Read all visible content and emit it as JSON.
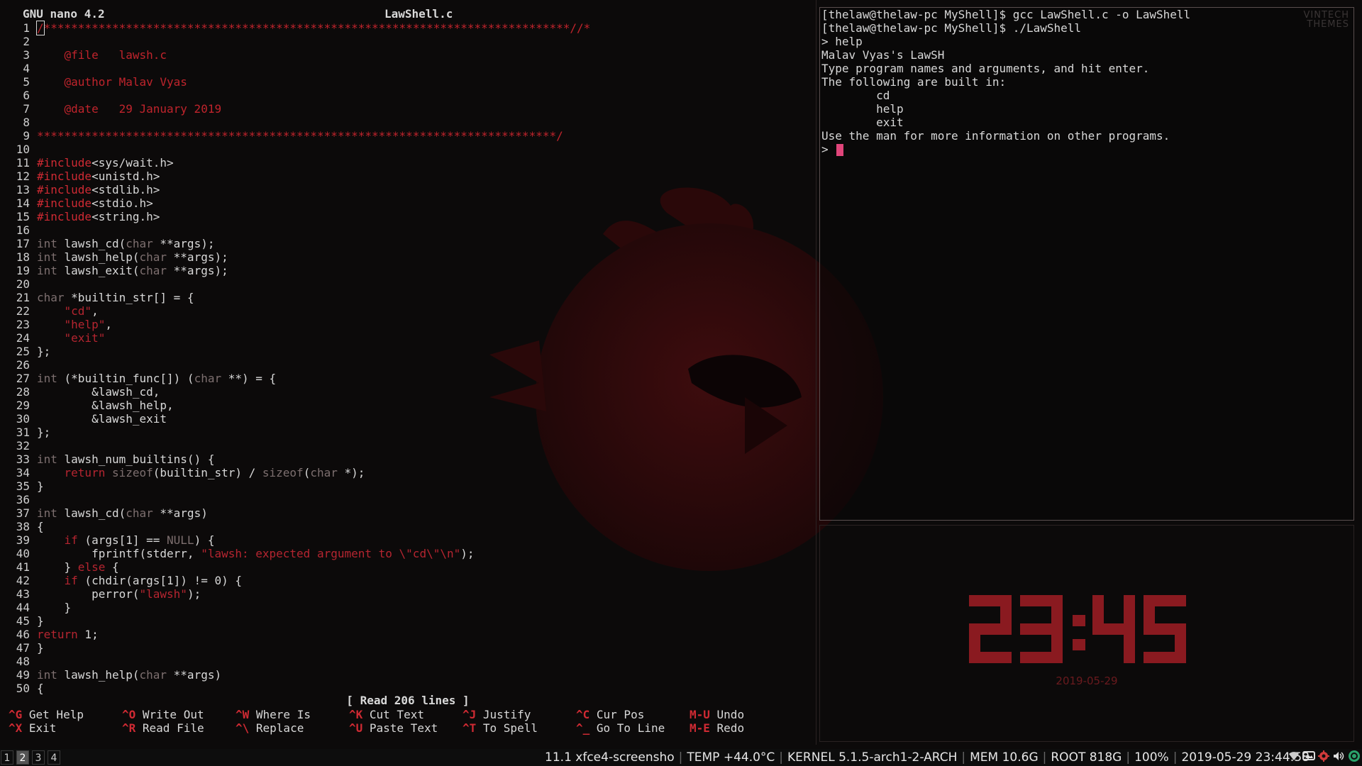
{
  "nano": {
    "version": "GNU nano 4.2",
    "filename": "LawShell.c",
    "status": "[ Read 206 lines ]",
    "lines": [
      {
        "n": "1",
        "seg": [
          [
            "comment",
            "/*****************************************************************************//*"
          ]
        ]
      },
      {
        "n": "2",
        "seg": []
      },
      {
        "n": "3",
        "seg": [
          [
            "comment",
            "    @file   lawsh.c"
          ]
        ]
      },
      {
        "n": "4",
        "seg": []
      },
      {
        "n": "5",
        "seg": [
          [
            "comment",
            "    @author Malav Vyas"
          ]
        ]
      },
      {
        "n": "6",
        "seg": []
      },
      {
        "n": "7",
        "seg": [
          [
            "comment",
            "    @date   29 January 2019"
          ]
        ]
      },
      {
        "n": "8",
        "seg": []
      },
      {
        "n": "9",
        "seg": [
          [
            "comment",
            "****************************************************************************/"
          ]
        ]
      },
      {
        "n": "10",
        "seg": []
      },
      {
        "n": "11",
        "seg": [
          [
            "pre",
            "#include"
          ],
          [
            "inc",
            "<sys/wait.h>"
          ]
        ]
      },
      {
        "n": "12",
        "seg": [
          [
            "pre",
            "#include"
          ],
          [
            "inc",
            "<unistd.h>"
          ]
        ]
      },
      {
        "n": "13",
        "seg": [
          [
            "pre",
            "#include"
          ],
          [
            "inc",
            "<stdlib.h>"
          ]
        ]
      },
      {
        "n": "14",
        "seg": [
          [
            "pre",
            "#include"
          ],
          [
            "inc",
            "<stdio.h>"
          ]
        ]
      },
      {
        "n": "15",
        "seg": [
          [
            "pre",
            "#include"
          ],
          [
            "inc",
            "<string.h>"
          ]
        ]
      },
      {
        "n": "16",
        "seg": []
      },
      {
        "n": "17",
        "seg": [
          [
            "type",
            "int"
          ],
          [
            "norm",
            " lawsh_cd("
          ],
          [
            "type",
            "char"
          ],
          [
            "norm",
            " **args);"
          ]
        ]
      },
      {
        "n": "18",
        "seg": [
          [
            "type",
            "int"
          ],
          [
            "norm",
            " lawsh_help("
          ],
          [
            "type",
            "char"
          ],
          [
            "norm",
            " **args);"
          ]
        ]
      },
      {
        "n": "19",
        "seg": [
          [
            "type",
            "int"
          ],
          [
            "norm",
            " lawsh_exit("
          ],
          [
            "type",
            "char"
          ],
          [
            "norm",
            " **args);"
          ]
        ]
      },
      {
        "n": "20",
        "seg": []
      },
      {
        "n": "21",
        "seg": [
          [
            "type",
            "char"
          ],
          [
            "norm",
            " *builtin_str[] = {"
          ]
        ]
      },
      {
        "n": "22",
        "seg": [
          [
            "norm",
            "    "
          ],
          [
            "str",
            "\"cd\""
          ],
          [
            "norm",
            ","
          ]
        ]
      },
      {
        "n": "23",
        "seg": [
          [
            "norm",
            "    "
          ],
          [
            "str",
            "\"help\""
          ],
          [
            "norm",
            ","
          ]
        ]
      },
      {
        "n": "24",
        "seg": [
          [
            "norm",
            "    "
          ],
          [
            "str",
            "\"exit\""
          ]
        ]
      },
      {
        "n": "25",
        "seg": [
          [
            "norm",
            "};"
          ]
        ]
      },
      {
        "n": "26",
        "seg": []
      },
      {
        "n": "27",
        "seg": [
          [
            "type",
            "int"
          ],
          [
            "norm",
            " (*builtin_func[]) ("
          ],
          [
            "type",
            "char"
          ],
          [
            "norm",
            " **) = {"
          ]
        ]
      },
      {
        "n": "28",
        "seg": [
          [
            "norm",
            "        &lawsh_cd,"
          ]
        ]
      },
      {
        "n": "29",
        "seg": [
          [
            "norm",
            "        &lawsh_help,"
          ]
        ]
      },
      {
        "n": "30",
        "seg": [
          [
            "norm",
            "        &lawsh_exit"
          ]
        ]
      },
      {
        "n": "31",
        "seg": [
          [
            "norm",
            "};"
          ]
        ]
      },
      {
        "n": "32",
        "seg": []
      },
      {
        "n": "33",
        "seg": [
          [
            "type",
            "int"
          ],
          [
            "norm",
            " lawsh_num_builtins() {"
          ]
        ]
      },
      {
        "n": "34",
        "seg": [
          [
            "norm",
            "    "
          ],
          [
            "kw",
            "return"
          ],
          [
            "norm",
            " "
          ],
          [
            "type",
            "sizeof"
          ],
          [
            "norm",
            "(builtin_str) / "
          ],
          [
            "type",
            "sizeof"
          ],
          [
            "norm",
            "("
          ],
          [
            "type",
            "char"
          ],
          [
            "norm",
            " *);"
          ]
        ]
      },
      {
        "n": "35",
        "seg": [
          [
            "norm",
            "}"
          ]
        ]
      },
      {
        "n": "36",
        "seg": []
      },
      {
        "n": "37",
        "seg": [
          [
            "type",
            "int"
          ],
          [
            "norm",
            " lawsh_cd("
          ],
          [
            "type",
            "char"
          ],
          [
            "norm",
            " **args)"
          ]
        ]
      },
      {
        "n": "38",
        "seg": [
          [
            "norm",
            "{"
          ]
        ]
      },
      {
        "n": "39",
        "seg": [
          [
            "norm",
            "    "
          ],
          [
            "kw",
            "if"
          ],
          [
            "norm",
            " (args[1] == "
          ],
          [
            "null",
            "NULL"
          ],
          [
            "norm",
            ") {"
          ]
        ]
      },
      {
        "n": "40",
        "seg": [
          [
            "norm",
            "        fprintf(stderr, "
          ],
          [
            "str",
            "\"lawsh: expected argument to \\\"cd\\\"\\n\""
          ],
          [
            "norm",
            ");"
          ]
        ]
      },
      {
        "n": "41",
        "seg": [
          [
            "norm",
            "    } "
          ],
          [
            "kw",
            "else"
          ],
          [
            "norm",
            " {"
          ]
        ]
      },
      {
        "n": "42",
        "seg": [
          [
            "norm",
            "    "
          ],
          [
            "kw",
            "if"
          ],
          [
            "norm",
            " (chdir(args[1]) != 0) {"
          ]
        ]
      },
      {
        "n": "43",
        "seg": [
          [
            "norm",
            "        perror("
          ],
          [
            "str",
            "\"lawsh\""
          ],
          [
            "norm",
            ");"
          ]
        ]
      },
      {
        "n": "44",
        "seg": [
          [
            "norm",
            "    }"
          ]
        ]
      },
      {
        "n": "45",
        "seg": [
          [
            "norm",
            "}"
          ]
        ]
      },
      {
        "n": "46",
        "seg": [
          [
            "kw",
            "return"
          ],
          [
            "norm",
            " 1;"
          ]
        ]
      },
      {
        "n": "47",
        "seg": [
          [
            "norm",
            "}"
          ]
        ]
      },
      {
        "n": "48",
        "seg": []
      },
      {
        "n": "49",
        "seg": [
          [
            "type",
            "int"
          ],
          [
            "norm",
            " lawsh_help("
          ],
          [
            "type",
            "char"
          ],
          [
            "norm",
            " **args)"
          ]
        ]
      },
      {
        "n": "50",
        "seg": [
          [
            "norm",
            "{"
          ]
        ]
      }
    ],
    "shortcuts": [
      {
        "key": "^G",
        "label": "Get Help"
      },
      {
        "key": "^O",
        "label": "Write Out"
      },
      {
        "key": "^W",
        "label": "Where Is"
      },
      {
        "key": "^K",
        "label": "Cut Text"
      },
      {
        "key": "^J",
        "label": "Justify"
      },
      {
        "key": "^C",
        "label": "Cur Pos"
      },
      {
        "key": "M-U",
        "label": "Undo"
      },
      {
        "key": "^X",
        "label": "Exit"
      },
      {
        "key": "^R",
        "label": "Read File"
      },
      {
        "key": "^\\",
        "label": "Replace"
      },
      {
        "key": "^U",
        "label": "Paste Text"
      },
      {
        "key": "^T",
        "label": "To Spell"
      },
      {
        "key": "^_",
        "label": "Go To Line"
      },
      {
        "key": "M-E",
        "label": "Redo"
      }
    ]
  },
  "terminal": {
    "lines": [
      "[thelaw@thelaw-pc MyShell]$ gcc LawShell.c -o LawShell",
      "[thelaw@thelaw-pc MyShell]$ ./LawShell",
      "> help",
      "Malav Vyas's LawSH",
      "Type program names and arguments, and hit enter.",
      "The following are built in:",
      "        cd",
      "        help",
      "        exit",
      "Use the man for more information on other programs."
    ],
    "prompt": "> ",
    "watermark_line1": "VINTECH",
    "watermark_line2": "THEMES"
  },
  "clock": {
    "time": "23:45",
    "date": "2019-05-29",
    "color": "#8a1a20"
  },
  "panel": {
    "workspaces": [
      "1",
      "2",
      "3",
      "4"
    ],
    "active_workspace": "2",
    "window": "11.1 xfce4-screensho",
    "temp": "TEMP +44.0°C",
    "kernel": "KERNEL 5.1.5-arch1-2-ARCH",
    "mem": "MEM 10.6G",
    "root": "ROOT 818G",
    "volume": "100%",
    "datetime": "2019-05-29 23:44:58",
    "tray_icons": [
      "wifi-icon",
      "display-icon",
      "settings-icon",
      "volume-icon",
      "update-icon"
    ]
  },
  "colors": {
    "accent": "#cf2a33",
    "bird": "#3a0b0d",
    "cursor": "#e0457a"
  }
}
